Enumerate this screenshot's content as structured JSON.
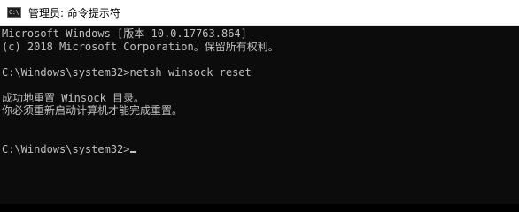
{
  "window": {
    "title": "管理员: 命令提示符",
    "icon": "cmd-icon",
    "icon_glyph": "C:\\"
  },
  "console": {
    "lines": [
      "Microsoft Windows [版本 10.0.17763.864]",
      "(c) 2018 Microsoft Corporation。保留所有权利。",
      "",
      "C:\\Windows\\system32>netsh winsock reset",
      "",
      "成功地重置 Winsock 目录。",
      "你必须重新启动计算机才能完成重置。",
      "",
      "",
      "C:\\Windows\\system32>"
    ]
  },
  "colors": {
    "console_background": "#0c0c0c",
    "console_text": "#c0c0c0",
    "titlebar_background": "#ffffff"
  }
}
